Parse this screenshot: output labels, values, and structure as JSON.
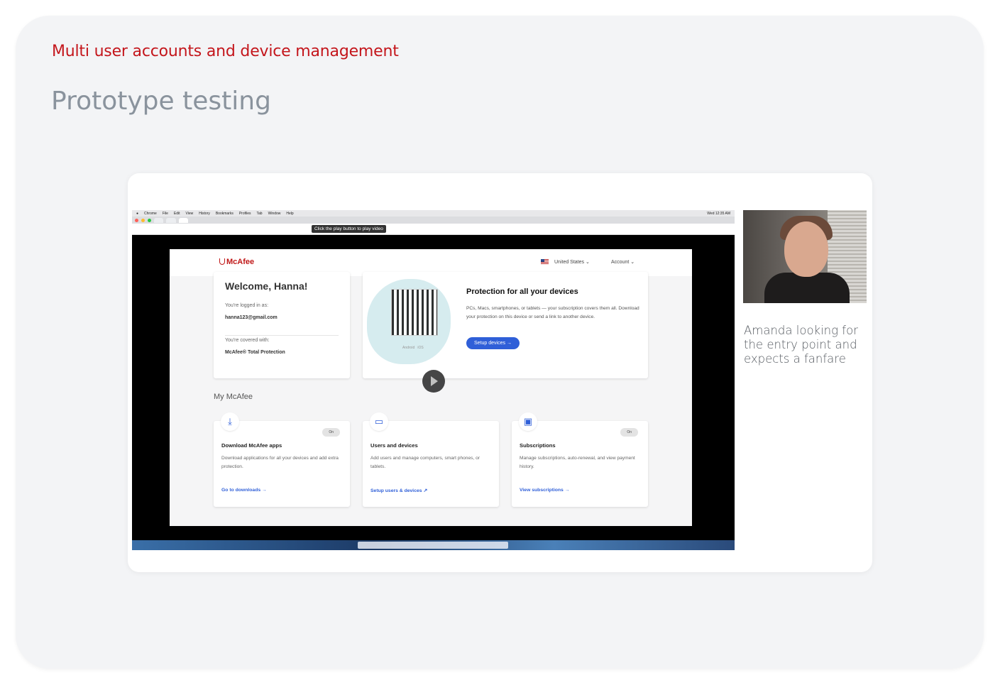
{
  "slide": {
    "kicker": "Multi user accounts and device management",
    "title": "Prototype testing",
    "caption": "Amanda looking for the entry point and expects a fanfare"
  },
  "browser": {
    "menu_items": [
      "Chrome",
      "File",
      "Edit",
      "View",
      "History",
      "Bookmarks",
      "Profiles",
      "Tab",
      "Window",
      "Help"
    ],
    "clock": "Wed 12:35 AM",
    "tooltip": "Click the play button to play video"
  },
  "mcafee": {
    "logo": "McAfee",
    "country": "United States",
    "account": "Account",
    "welcome": {
      "heading": "Welcome, Hanna!",
      "logged_in_label": "You're logged in as:",
      "email": "hanna123@gmail.com",
      "covered_label": "You're covered with:",
      "product": "McAfee® Total Protection"
    },
    "protection": {
      "heading": "Protection for all your devices",
      "body": "PCs, Macs, smartphones, or tablets — your subscription covers them all. Download your protection on this device or send a link to another device.",
      "button": "Setup devices",
      "os_android": "Android",
      "os_ios": "iOS"
    },
    "section_title": "My McAfee",
    "features": [
      {
        "title": "Download McAfee apps",
        "body": "Download applications for all your devices and add extra protection.",
        "link": "Go to downloads",
        "toggle": "On"
      },
      {
        "title": "Users and devices",
        "body": "Add users and manage computers, smart phones, or tablets.",
        "link": "Setup users & devices",
        "toggle": ""
      },
      {
        "title": "Subscriptions",
        "body": "Manage subscriptions, auto-renewal, and view payment history.",
        "link": "View subscriptions",
        "toggle": "On"
      }
    ]
  }
}
